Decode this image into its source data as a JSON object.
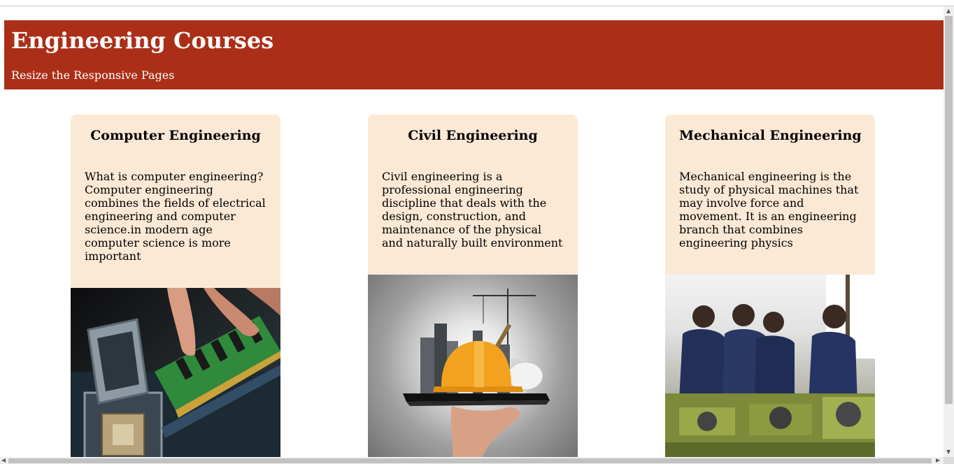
{
  "header": {
    "title": "Engineering Courses",
    "subtitle": "Resize the Responsive Pages",
    "background_color": "#ab2f18"
  },
  "cards": [
    {
      "title": "Computer Engineering",
      "text": "What is computer engineering? Computer engineering combines the fields of electrical engineering and computer science.in modern age computer science is more important",
      "image": "computer-hardware-image"
    },
    {
      "title": "Civil Engineering",
      "text": "Civil engineering is a professional engineering discipline that deals with the design, construction, and maintenance of the physical and naturally built environment",
      "image": "civil-construction-image"
    },
    {
      "title": "Mechanical Engineering",
      "text": "Mechanical engineering is the study of physical machines that may involve force and movement. It is an engineering branch that combines engineering physics",
      "image": "mechanical-workshop-image"
    }
  ],
  "colors": {
    "card_background": "#fbe9d6",
    "page_background": "#ffffff"
  }
}
